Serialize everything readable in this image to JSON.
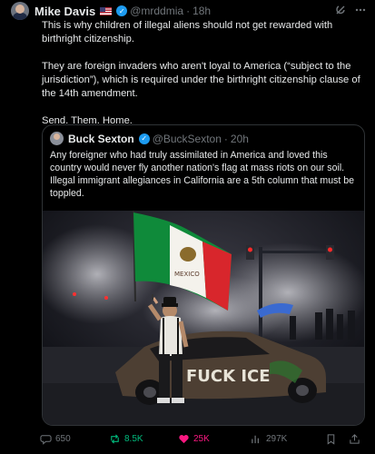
{
  "tweet": {
    "author_name": "Mike Davis",
    "handle": "@mrddmia",
    "separator": "·",
    "time": "18h",
    "paragraphs": [
      "This is why children of illegal aliens should not get rewarded with birthright citizenship.",
      "They are foreign invaders who aren't loyal to America (“subject to the jurisdiction”), which is required under the birthright citizenship clause of the 14th amendment.",
      "Send. Them. Home."
    ]
  },
  "quoted": {
    "author_name": "Buck Sexton",
    "handle": "@BuckSexton",
    "separator": "·",
    "time": "20h",
    "text": "Any foreigner who had truly assimilated in America and loved this country would never fly another nation's flag at mass riots on our soil. Illegal immigrant allegiances in California are a 5th column that must be toppled."
  },
  "photo": {
    "flag_word": "MEXICO",
    "graffiti": "FUCK ICE"
  },
  "actions": {
    "replies": "650",
    "reposts": "8.5K",
    "likes": "25K",
    "views": "297K"
  },
  "colors": {
    "background": "#000000",
    "text": "#e7e9ea",
    "muted": "#71767b",
    "verified": "#1d9bf0",
    "repost": "#00ba7c",
    "like": "#f91880",
    "border": "#2f3336"
  },
  "icons": [
    "verified-badge-icon",
    "grok-icon",
    "more-icon",
    "reply-icon",
    "repost-icon",
    "like-icon",
    "views-icon",
    "bookmark-icon",
    "share-icon"
  ]
}
